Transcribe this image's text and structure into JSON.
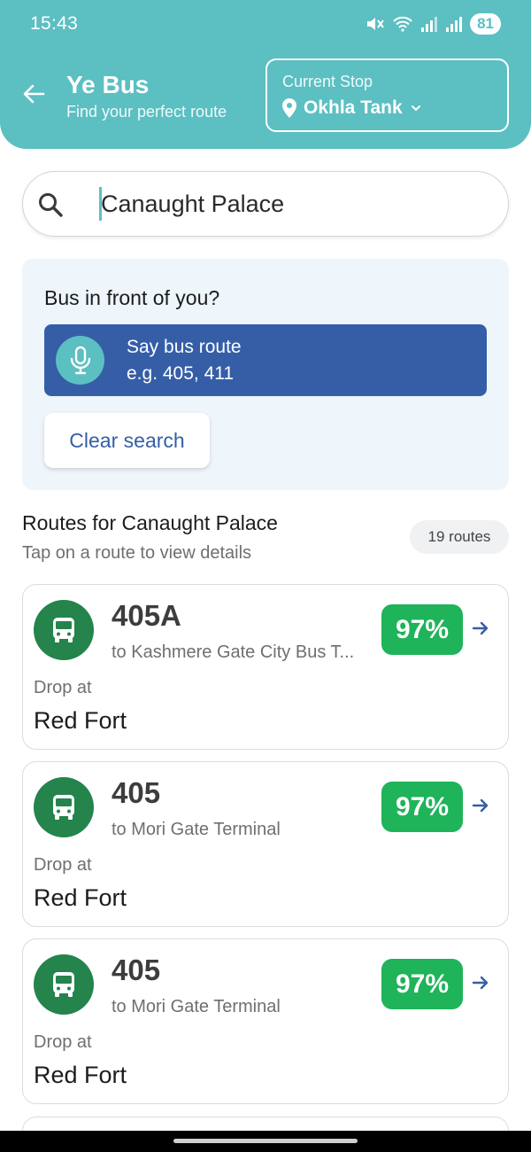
{
  "status_bar": {
    "time": "15:43",
    "battery": "81",
    "icons": [
      "mute-icon",
      "wifi-icon",
      "signal-icon",
      "signal-roaming-icon"
    ]
  },
  "header": {
    "title": "Ye Bus",
    "subtitle": "Find your perfect route",
    "back_icon": "arrow-left-icon",
    "current_stop_label": "Current Stop",
    "current_stop_value": "Okhla Tank",
    "stop_icon": "location-pin-icon",
    "dropdown_icon": "chevron-down-icon"
  },
  "search": {
    "value": "Canaught Palace",
    "icon": "search-icon"
  },
  "voice_card": {
    "question": "Bus in front of you?",
    "button_line1": "Say bus route",
    "button_line2": "e.g. 405, 411",
    "mic_icon": "microphone-icon",
    "clear_label": "Clear search"
  },
  "routes": {
    "title": "Routes for Canaught Palace",
    "subtitle": "Tap on a route to view details",
    "count": "19 routes",
    "items": [
      {
        "number": "405A",
        "destination": "to Kashmere Gate City Bus T...",
        "match": "97%",
        "drop_label": "Drop at",
        "drop_stop": "Red Fort"
      },
      {
        "number": "405",
        "destination": "to Mori Gate Terminal",
        "match": "97%",
        "drop_label": "Drop at",
        "drop_stop": "Red Fort"
      },
      {
        "number": "405",
        "destination": "to Mori Gate Terminal",
        "match": "97%",
        "drop_label": "Drop at",
        "drop_stop": "Red Fort"
      }
    ]
  },
  "colors": {
    "header_teal": "#5cbfc2",
    "voice_blue": "#355ea7",
    "bus_green": "#24844b",
    "badge_green": "#1fb35a"
  }
}
